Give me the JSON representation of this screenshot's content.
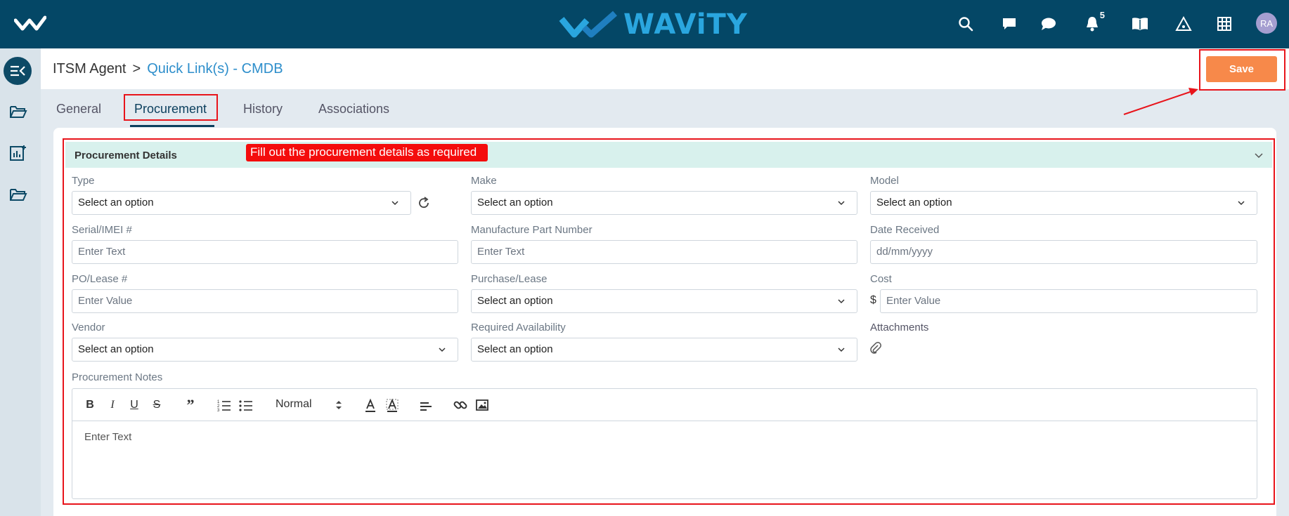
{
  "app": {
    "brand": "WAViTY",
    "notification_count": "5",
    "user_initials": "RA"
  },
  "breadcrumb": {
    "root": "ITSM Agent",
    "separator": ">",
    "current": "Quick Link(s) - CMDB"
  },
  "actions": {
    "save_label": "Save"
  },
  "tabs": [
    {
      "label": "General",
      "active": false
    },
    {
      "label": "Procurement",
      "active": true
    },
    {
      "label": "History",
      "active": false
    },
    {
      "label": "Associations",
      "active": false
    }
  ],
  "section": {
    "title": "Procurement Details",
    "annotation": "Fill out the procurement details as required"
  },
  "form": {
    "type": {
      "label": "Type",
      "value": "Select an option"
    },
    "make": {
      "label": "Make",
      "value": "Select an option"
    },
    "model": {
      "label": "Model",
      "value": "Select an option"
    },
    "serial": {
      "label": "Serial/IMEI #",
      "placeholder": "Enter Text"
    },
    "mfr_part": {
      "label": "Manufacture Part Number",
      "placeholder": "Enter Text"
    },
    "date_received": {
      "label": "Date Received",
      "placeholder": "dd/mm/yyyy"
    },
    "po_lease": {
      "label": "PO/Lease #",
      "placeholder": "Enter Value"
    },
    "purchase_lease": {
      "label": "Purchase/Lease",
      "value": "Select an option"
    },
    "cost": {
      "label": "Cost",
      "currency": "$",
      "placeholder": "Enter Value"
    },
    "vendor": {
      "label": "Vendor",
      "value": "Select an option"
    },
    "required_availability": {
      "label": "Required Availability",
      "value": "Select an option"
    },
    "attachments": {
      "label": "Attachments"
    },
    "notes": {
      "label": "Procurement Notes",
      "format": "Normal",
      "placeholder": "Enter Text"
    }
  },
  "colors": {
    "topbar": "#044766",
    "accent": "#2aa6df",
    "save": "#f7894a",
    "annotation": "#e8141b",
    "section_header": "#d8f1ed"
  }
}
